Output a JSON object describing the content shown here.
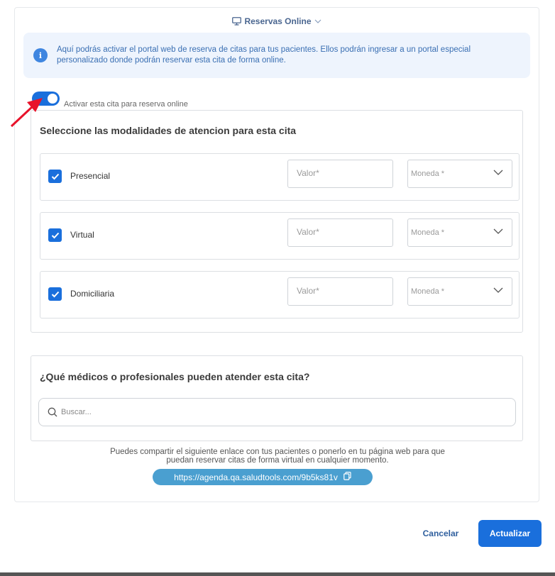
{
  "header": {
    "title": "Reservas Online",
    "icon": "monitor-icon"
  },
  "info": {
    "text": "Aquí podrás activar el portal web de reserva de citas para tus pacientes. Ellos podrán ingresar a un portal especial personalizado donde podrán reservar esta cita de forma online."
  },
  "toggle": {
    "label": "Activar esta cita para reserva online",
    "on": true
  },
  "modalidades": {
    "title": "Seleccione las modalidades de atencion para esta cita",
    "rows": [
      {
        "label": "Presencial",
        "checked": true,
        "valor_placeholder": "Valor*",
        "moneda_placeholder": "Moneda *"
      },
      {
        "label": "Virtual",
        "checked": true,
        "valor_placeholder": "Valor*",
        "moneda_placeholder": "Moneda *"
      },
      {
        "label": "Domiciliaria",
        "checked": true,
        "valor_placeholder": "Valor*",
        "moneda_placeholder": "Moneda *"
      }
    ]
  },
  "medicos": {
    "title": "¿Qué médicos o profesionales pueden atender esta cita?",
    "search_placeholder": "Buscar..."
  },
  "share": {
    "line1": "Puedes compartir el siguiente enlace con tus pacientes o ponerlo en tu página web para que",
    "line2": "puedan reservar citas de forma virtual en cualquier momento.",
    "url": "https://agenda.qa.saludtools.com/9b5ks81v"
  },
  "footer": {
    "cancel": "Cancelar",
    "save": "Actualizar"
  },
  "colors": {
    "primary": "#1a6fdc",
    "info_bg": "#eef4fd",
    "link_pill": "#4a9fd0",
    "arrow": "#e8132b"
  }
}
